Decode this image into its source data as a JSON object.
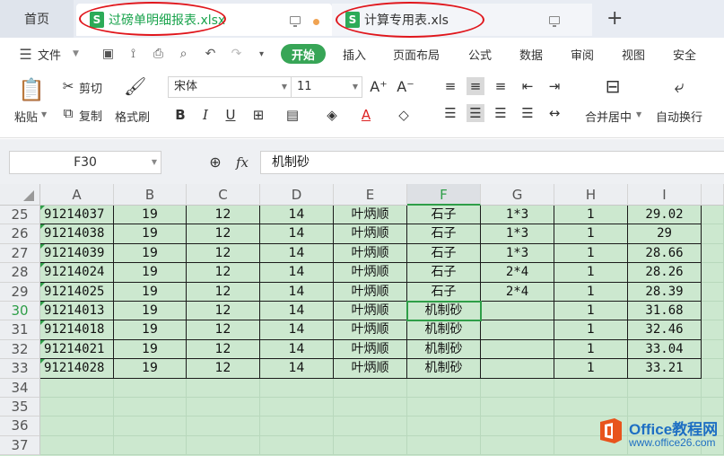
{
  "tabs": {
    "home": "首页",
    "tab1": {
      "name": "过磅单明细报表.xlsx",
      "icon": "S"
    },
    "tab2": {
      "name": "计算专用表.xls",
      "icon": "S"
    },
    "new_tab": "+"
  },
  "menu": {
    "file": "文件",
    "items": [
      "开始",
      "插入",
      "页面布局",
      "公式",
      "数据",
      "审阅",
      "视图",
      "安全"
    ]
  },
  "ribbon": {
    "paste": "粘贴",
    "cut": "剪切",
    "copy": "复制",
    "format_painter": "格式刷",
    "font_name": "宋体",
    "font_size": "11",
    "merge_center": "合并居中",
    "wrap_text": "自动换行"
  },
  "formula_bar": {
    "name_box": "F30",
    "fx": "fx",
    "content": "机制砂"
  },
  "sheet": {
    "columns": [
      "A",
      "B",
      "C",
      "D",
      "E",
      "F",
      "G",
      "H",
      "I"
    ],
    "active_column": "F",
    "active_row": "30",
    "rows": [
      {
        "num": "25",
        "cells": [
          "91214037",
          "19",
          "12",
          "14",
          "叶炳顺",
          "石子",
          "1*3",
          "1",
          "29.02"
        ]
      },
      {
        "num": "26",
        "cells": [
          "91214038",
          "19",
          "12",
          "14",
          "叶炳顺",
          "石子",
          "1*3",
          "1",
          "29"
        ]
      },
      {
        "num": "27",
        "cells": [
          "91214039",
          "19",
          "12",
          "14",
          "叶炳顺",
          "石子",
          "1*3",
          "1",
          "28.66"
        ]
      },
      {
        "num": "28",
        "cells": [
          "91214024",
          "19",
          "12",
          "14",
          "叶炳顺",
          "石子",
          "2*4",
          "1",
          "28.26"
        ]
      },
      {
        "num": "29",
        "cells": [
          "91214025",
          "19",
          "12",
          "14",
          "叶炳顺",
          "石子",
          "2*4",
          "1",
          "28.39"
        ]
      },
      {
        "num": "30",
        "cells": [
          "91214013",
          "19",
          "12",
          "14",
          "叶炳顺",
          "机制砂",
          "",
          "1",
          "31.68"
        ]
      },
      {
        "num": "31",
        "cells": [
          "91214018",
          "19",
          "12",
          "14",
          "叶炳顺",
          "机制砂",
          "",
          "1",
          "32.46"
        ]
      },
      {
        "num": "32",
        "cells": [
          "91214021",
          "19",
          "12",
          "14",
          "叶炳顺",
          "机制砂",
          "",
          "1",
          "33.04"
        ]
      },
      {
        "num": "33",
        "cells": [
          "91214028",
          "19",
          "12",
          "14",
          "叶炳顺",
          "机制砂",
          "",
          "1",
          "33.21"
        ]
      },
      {
        "num": "34",
        "cells": [
          "",
          "",
          "",
          "",
          "",
          "",
          "",
          "",
          ""
        ]
      },
      {
        "num": "35",
        "cells": [
          "",
          "",
          "",
          "",
          "",
          "",
          "",
          "",
          ""
        ]
      },
      {
        "num": "36",
        "cells": [
          "",
          "",
          "",
          "",
          "",
          "",
          "",
          "",
          ""
        ]
      },
      {
        "num": "37",
        "cells": [
          "",
          "",
          "",
          "",
          "",
          "",
          "",
          "",
          ""
        ]
      }
    ]
  },
  "watermark": {
    "brand": "Office教程网",
    "url": "www.office26.com"
  },
  "colors": {
    "accent_green": "#37a556",
    "grid_green": "#cce8cf",
    "highlight_red": "#e0161c"
  }
}
